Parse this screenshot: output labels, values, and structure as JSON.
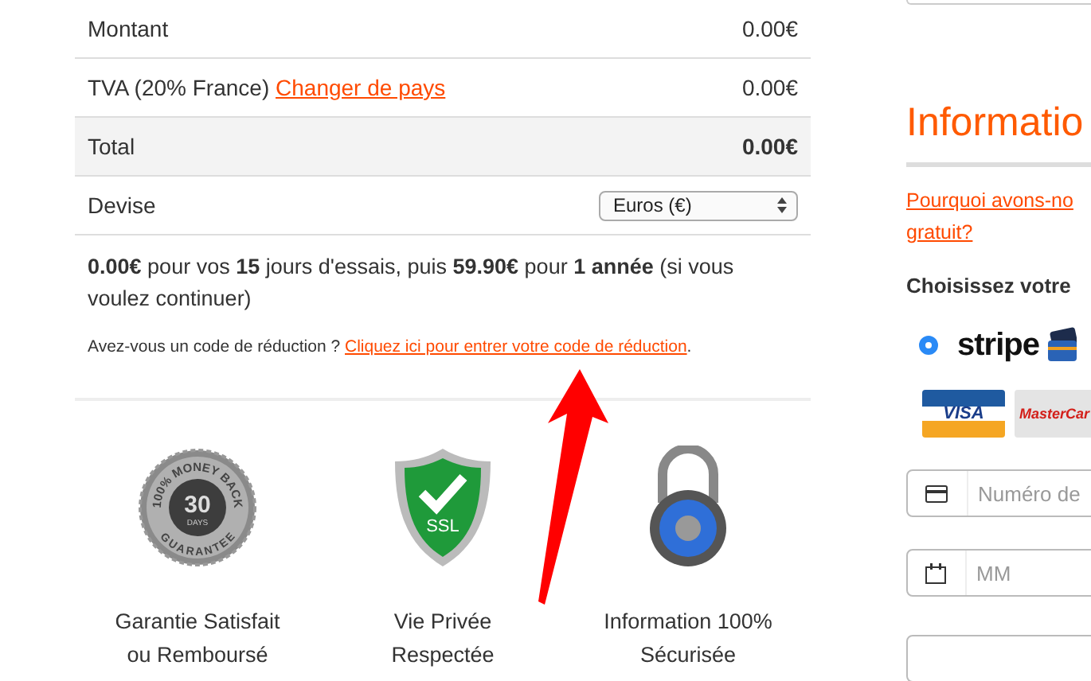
{
  "summary": {
    "rows": [
      {
        "kind": "plain",
        "label": "Montant",
        "value": "0.00€"
      },
      {
        "kind": "link",
        "label": "TVA (20% France)",
        "link": "Changer de pays",
        "value": "0.00€"
      },
      {
        "kind": "total",
        "label": "Total",
        "value": "0.00€"
      },
      {
        "kind": "select",
        "label": "Devise",
        "value": "Euros (€)"
      }
    ],
    "offer": "**0.00€** pour vos **15** jours d'essais, puis **59.90€** pour **1 année** (si vous voulez continuer)",
    "discount": {
      "text": "Avez-vous un code de réduction ?",
      "link": "Cliquez ici pour entrer votre code de réduction",
      "end": "."
    }
  },
  "badges": [
    {
      "kind": "guarantee",
      "label": "Garantie Satisfait ou Remboursé",
      "arc_top": "100% MONEY BACK",
      "number": "30",
      "unit": "DAYS",
      "arc_bottom": "GUARANTEE"
    },
    {
      "kind": "ssl",
      "label": "Vie Privée Respectée",
      "text": "SSL"
    },
    {
      "kind": "lock",
      "label": "Information 100% Sécurisée"
    }
  ],
  "payment": {
    "title": "Informatio",
    "why_link": "Pourquoi avons-no gratuit?",
    "choose": "Choisissez votre",
    "methods": [
      {
        "name": "stripe",
        "selected": true
      }
    ],
    "cards": [
      "VISA",
      "MasterCar"
    ],
    "fields": [
      {
        "kind": "card",
        "placeholder": "Numéro de"
      },
      {
        "kind": "date",
        "placeholder": "MM"
      }
    ]
  }
}
